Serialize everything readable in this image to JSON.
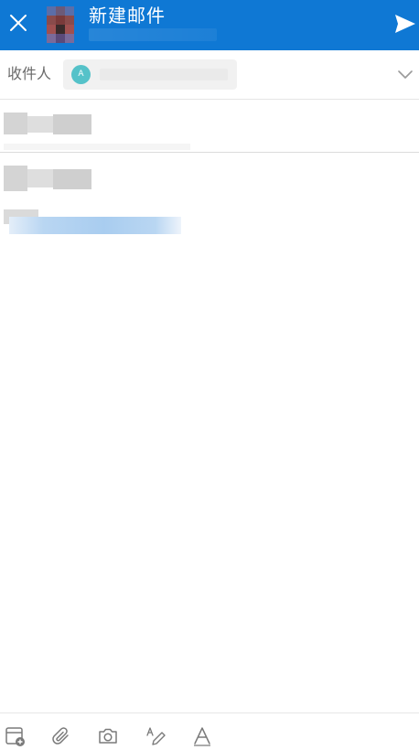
{
  "header": {
    "title": "新建邮件",
    "background": "#0f78d4"
  },
  "recipients": {
    "label": "收件人",
    "chip_initial": "A",
    "chip_color": "#55c2c9"
  },
  "icons": {
    "close": "close-icon",
    "send": "send-icon",
    "expand": "chevron-down-icon",
    "calendar": "calendar-add-icon",
    "attach": "paperclip-icon",
    "camera": "camera-icon",
    "draw": "pen-icon",
    "format": "text-format-icon"
  }
}
